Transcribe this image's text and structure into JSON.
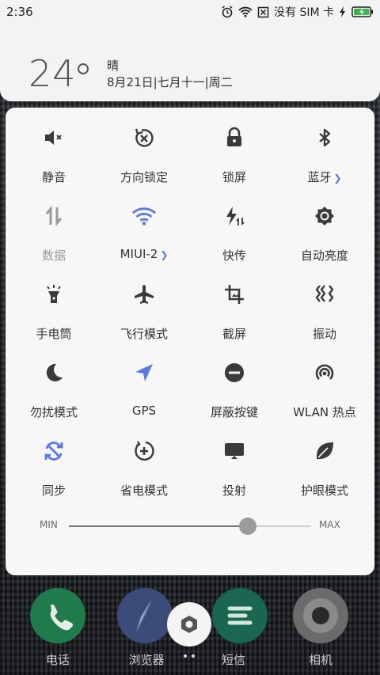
{
  "status_bar": {
    "time": "2:36",
    "carrier_text": "没有 SIM 卡"
  },
  "weather": {
    "temperature": "24",
    "condition": "晴",
    "date": "8月21日|七月十一|周二"
  },
  "tiles": [
    {
      "label": "静音",
      "icon": "mute-icon"
    },
    {
      "label": "方向锁定",
      "icon": "rotation-lock-icon"
    },
    {
      "label": "锁屏",
      "icon": "lock-icon"
    },
    {
      "label": "蓝牙",
      "icon": "bluetooth-icon"
    },
    {
      "label": "数据",
      "icon": "mobile-data-icon"
    },
    {
      "label": "MIUI-2",
      "icon": "wifi-icon"
    },
    {
      "label": "快传",
      "icon": "quick-transfer-icon"
    },
    {
      "label": "自动亮度",
      "icon": "auto-brightness-icon"
    },
    {
      "label": "手电筒",
      "icon": "flashlight-icon"
    },
    {
      "label": "飞行模式",
      "icon": "airplane-icon"
    },
    {
      "label": "截屏",
      "icon": "screenshot-crop-icon"
    },
    {
      "label": "振动",
      "icon": "vibrate-icon"
    },
    {
      "label": "勿扰模式",
      "icon": "moon-icon"
    },
    {
      "label": "GPS",
      "icon": "gps-arrow-icon"
    },
    {
      "label": "屏蔽按键",
      "icon": "block-keys-icon"
    },
    {
      "label": "WLAN 热点",
      "icon": "hotspot-icon"
    },
    {
      "label": "同步",
      "icon": "sync-icon"
    },
    {
      "label": "省电模式",
      "icon": "battery-saver-icon"
    },
    {
      "label": "投射",
      "icon": "cast-screen-icon"
    },
    {
      "label": "护眼模式",
      "icon": "leaf-icon"
    }
  ],
  "brightness": {
    "min_label": "MIN",
    "max_label": "MAX",
    "level": 0.74
  },
  "dock": {
    "apps": [
      {
        "label": "电话",
        "icon": "phone-icon"
      },
      {
        "label": "浏览器",
        "icon": "compass-icon"
      },
      {
        "label": "短信",
        "icon": "messages-icon"
      },
      {
        "label": "相机",
        "icon": "camera-icon"
      }
    ]
  },
  "colors": {
    "accent_active": "#5a78e6",
    "icon_default": "#3a3a3a",
    "icon_inactive": "#9a9a9a"
  }
}
